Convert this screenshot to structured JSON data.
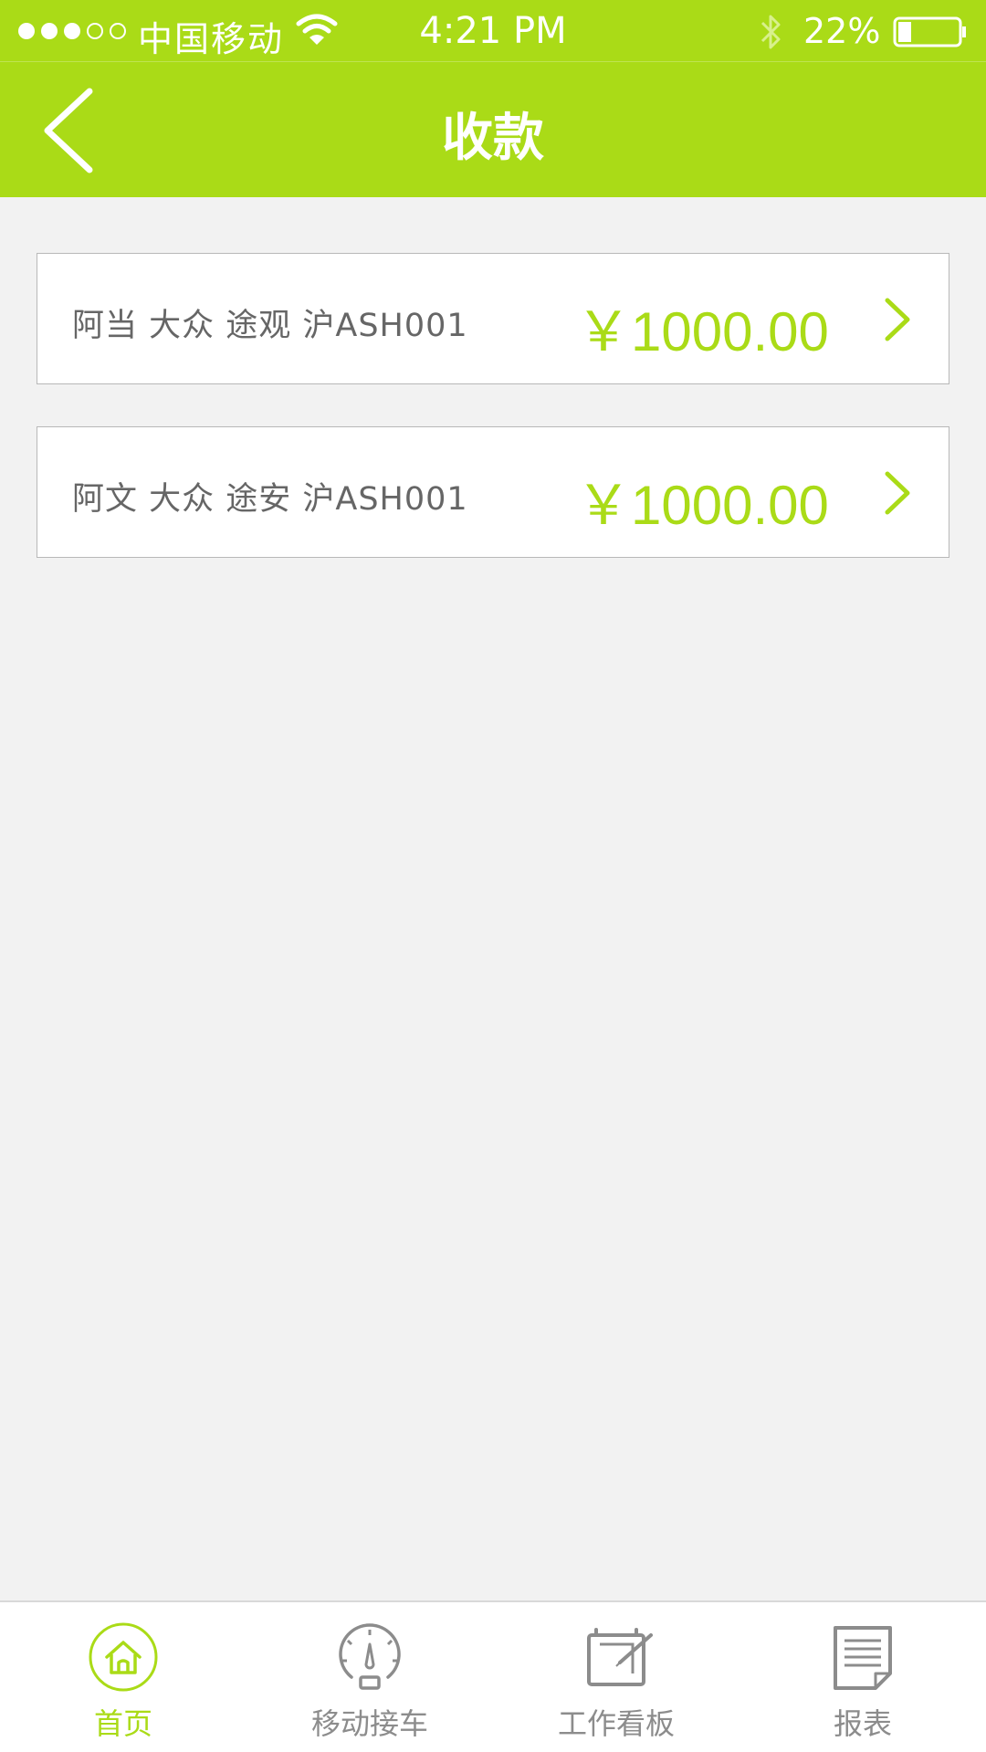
{
  "status_bar": {
    "carrier": "中国移动",
    "time": "4:21 PM",
    "battery": "22%"
  },
  "nav": {
    "title": "收款"
  },
  "payments": [
    {
      "customer": "阿当   大众  途观   沪ASH001",
      "amount": "￥1000.00"
    },
    {
      "customer": "阿文   大众  途安   沪ASH001",
      "amount": "￥1000.00"
    }
  ],
  "tabs": [
    {
      "label": "首页",
      "icon": "home-icon",
      "active": true
    },
    {
      "label": "移动接车",
      "icon": "gauge-icon",
      "active": false
    },
    {
      "label": "工作看板",
      "icon": "board-icon",
      "active": false
    },
    {
      "label": "报表",
      "icon": "report-icon",
      "active": false
    }
  ],
  "colors": {
    "brand": "#aadb17",
    "background": "#f2f2f2",
    "text_secondary": "#666666",
    "tab_inactive": "#8c8c8c"
  }
}
